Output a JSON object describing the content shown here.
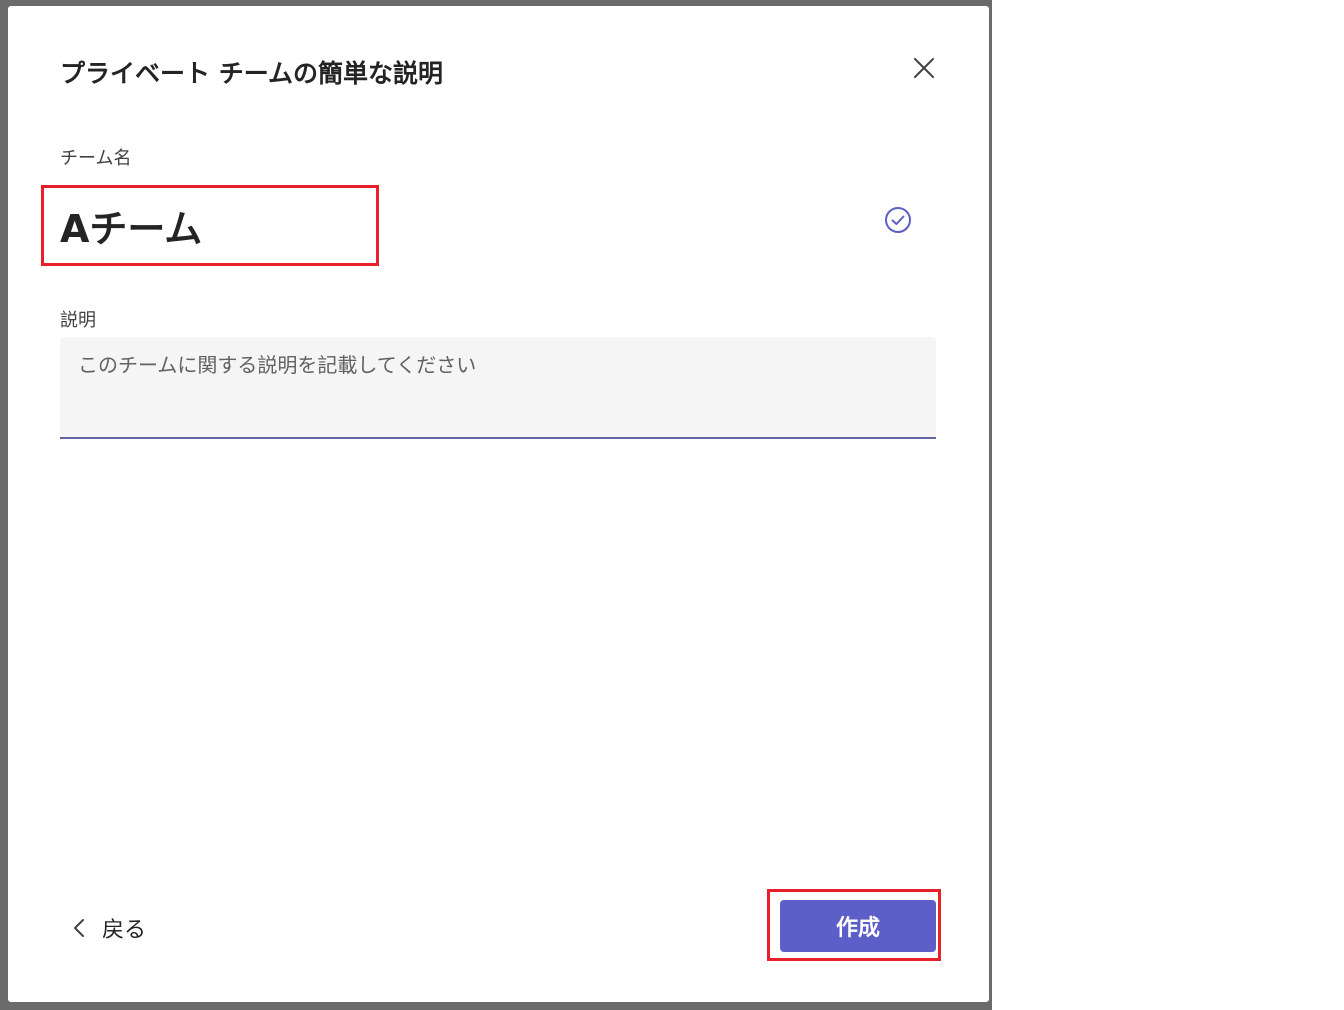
{
  "dialog": {
    "title": "プライベート チームの簡単な説明",
    "close_icon": "close-icon"
  },
  "team_name": {
    "label": "チーム名",
    "value": "Aチーム",
    "status_icon": "check-circle-icon"
  },
  "description": {
    "label": "説明",
    "placeholder": "このチームに関する説明を記載してください",
    "value": ""
  },
  "footer": {
    "back_label": "戻る",
    "back_icon": "chevron-left-icon",
    "create_label": "作成"
  },
  "colors": {
    "accent": "#5b5fc7",
    "highlight": "#e8202a",
    "backdrop": "#6b6b6b"
  }
}
